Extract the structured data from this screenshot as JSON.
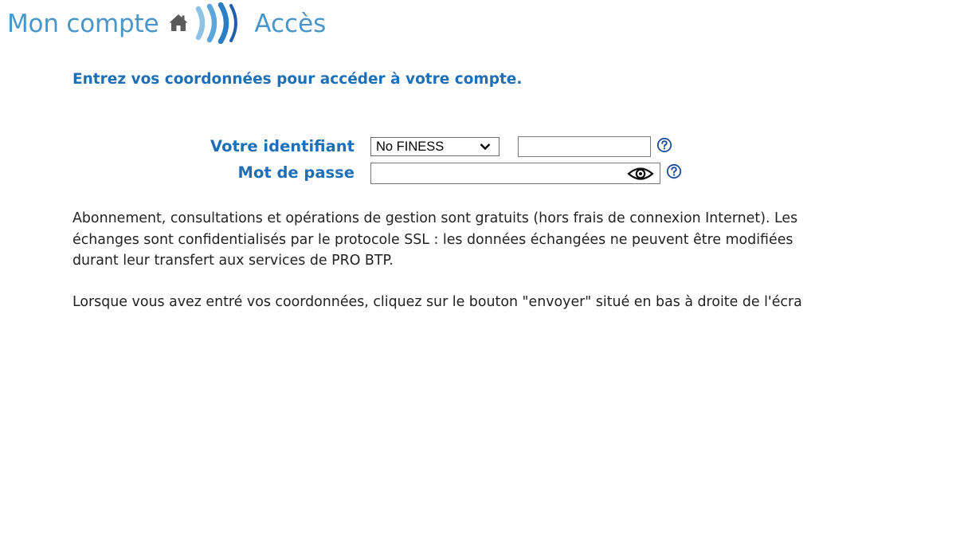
{
  "header": {
    "title": "Mon compte",
    "section": "Accès",
    "icons": [
      "home-icon",
      "waves-icon"
    ],
    "color": "#4a96c9"
  },
  "intro": "Entrez vos coordonnées pour accéder à votre compte.",
  "form": {
    "identifier_label": "Votre identifiant",
    "identifier_type_selected": "No FINESS",
    "identifier_value": "",
    "password_label": "Mot de passe",
    "password_value": "",
    "label_color": "#1e6fb8"
  },
  "info": {
    "lines": [
      "Abonnement, consultations et opérations de gestion sont gratuits (hors frais de connexion Internet). Les",
      "échanges sont confidentialisés par le protocole SSL : les données échangées ne peuvent être modifiées",
      "durant leur transfert aux services de PRO BTP."
    ],
    "instruction": "Lorsque vous avez entré vos coordonnées, cliquez sur le bouton \"envoyer\" situé en bas à droite de l'écra"
  }
}
